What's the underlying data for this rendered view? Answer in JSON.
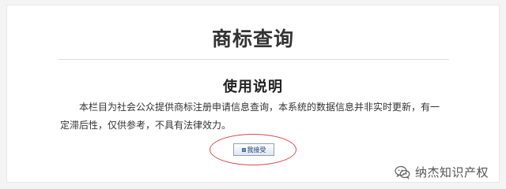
{
  "page": {
    "title": "商标查询"
  },
  "instructions": {
    "heading": "使用说明",
    "body": "本栏目为社会公众提供商标注册申请信息查询，本系统的数据信息并非实时更新，有一定滞后性，仅供参考，不具有法律效力。"
  },
  "actions": {
    "accept_label": "我接受"
  },
  "watermark": {
    "text": "纳杰知识产权",
    "icon": "wechat-icon"
  },
  "colors": {
    "background": "#f4f4f4",
    "card": "#ffffff",
    "title_text": "#333333",
    "highlight": "#d84b4b",
    "button_border": "#8aa0be"
  }
}
